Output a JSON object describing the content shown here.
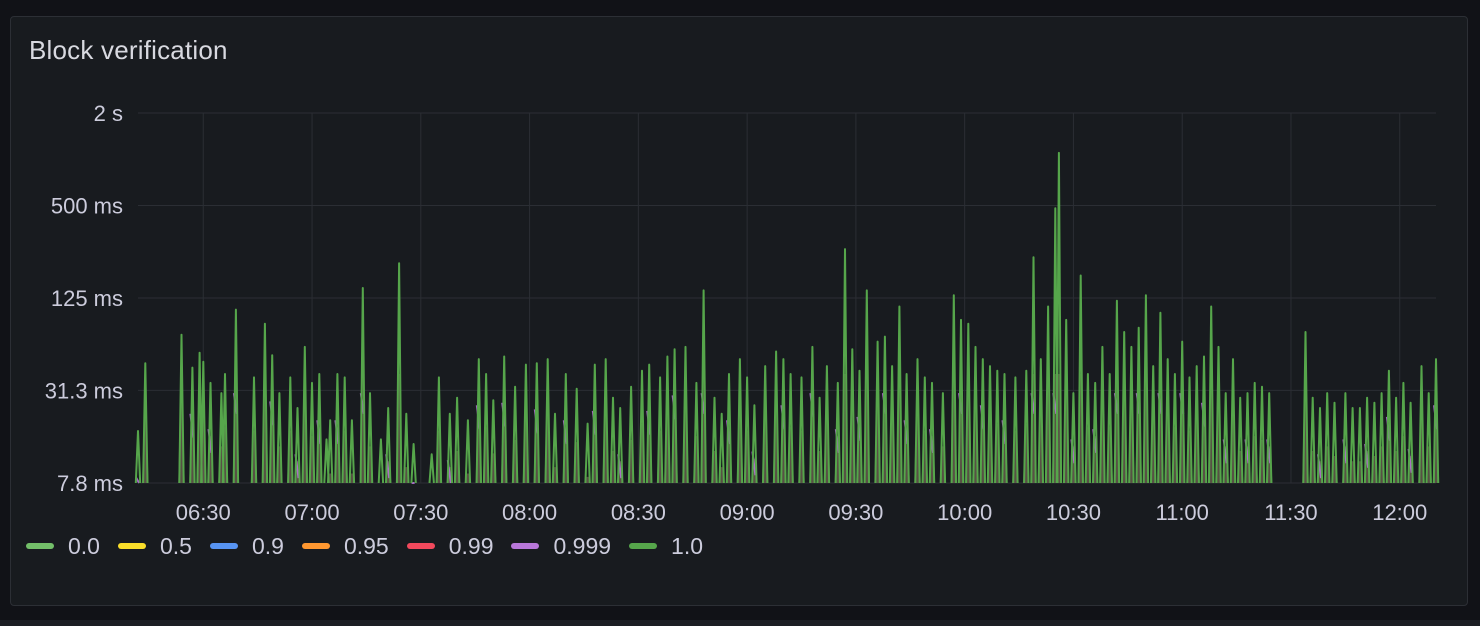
{
  "panel": {
    "title": "Block verification"
  },
  "colors": {
    "background": "#111217",
    "panel": "#181b1f",
    "grid": "#2b2e34",
    "text": "#ccccdc"
  },
  "legend": [
    {
      "label": "0.0",
      "color": "#73bf69"
    },
    {
      "label": "0.5",
      "color": "#fade2a"
    },
    {
      "label": "0.9",
      "color": "#5794f2"
    },
    {
      "label": "0.95",
      "color": "#ff9830"
    },
    {
      "label": "0.99",
      "color": "#f2495c"
    },
    {
      "label": "0.999",
      "color": "#b877d9"
    },
    {
      "label": "1.0",
      "color": "#56a64b"
    }
  ],
  "chart_data": {
    "type": "line",
    "title": "Block verification",
    "y_scale": "log2",
    "ylim_ms": [
      7.8,
      2000
    ],
    "y_ticks": [
      {
        "value": 2000,
        "label": "2 s"
      },
      {
        "value": 500,
        "label": "500 ms"
      },
      {
        "value": 125,
        "label": "125 ms"
      },
      {
        "value": 31.3,
        "label": "31.3 ms"
      },
      {
        "value": 7.8,
        "label": "7.8 ms"
      }
    ],
    "x_range": [
      "06:12",
      "12:10"
    ],
    "x_ticks": [
      "06:30",
      "07:00",
      "07:30",
      "08:00",
      "08:30",
      "09:00",
      "09:30",
      "10:00",
      "10:30",
      "11:00",
      "11:30",
      "12:00"
    ],
    "grid": true,
    "legend_position": "bottom-left",
    "series_1_0_spikes": [
      [
        "06:12",
        17
      ],
      [
        "06:14",
        47
      ],
      [
        "06:24",
        72
      ],
      [
        "06:27",
        44
      ],
      [
        "06:29",
        55
      ],
      [
        "06:30",
        48
      ],
      [
        "06:32",
        35
      ],
      [
        "06:35",
        30
      ],
      [
        "06:36",
        40
      ],
      [
        "06:39",
        105
      ],
      [
        "06:44",
        38
      ],
      [
        "06:47",
        85
      ],
      [
        "06:49",
        53
      ],
      [
        "06:51",
        30
      ],
      [
        "06:54",
        38
      ],
      [
        "06:56",
        24
      ],
      [
        "06:58",
        60
      ],
      [
        "07:00",
        35
      ],
      [
        "07:02",
        40
      ],
      [
        "07:04",
        15
      ],
      [
        "07:05",
        20
      ],
      [
        "07:07",
        40
      ],
      [
        "07:09",
        38
      ],
      [
        "07:11",
        20
      ],
      [
        "07:14",
        145
      ],
      [
        "07:16",
        30
      ],
      [
        "07:19",
        15
      ],
      [
        "07:21",
        24
      ],
      [
        "07:24",
        210
      ],
      [
        "07:26",
        22
      ],
      [
        "07:28",
        14
      ],
      [
        "07:33",
        12
      ],
      [
        "07:35",
        38
      ],
      [
        "07:38",
        22
      ],
      [
        "07:40",
        28
      ],
      [
        "07:43",
        20
      ],
      [
        "07:46",
        50
      ],
      [
        "07:48",
        40
      ],
      [
        "07:50",
        27
      ],
      [
        "07:53",
        52
      ],
      [
        "07:56",
        33
      ],
      [
        "07:59",
        46
      ],
      [
        "08:02",
        47
      ],
      [
        "08:05",
        50
      ],
      [
        "08:07",
        22
      ],
      [
        "08:10",
        40
      ],
      [
        "08:13",
        32
      ],
      [
        "08:16",
        19
      ],
      [
        "08:18",
        46
      ],
      [
        "08:21",
        50
      ],
      [
        "08:23",
        28
      ],
      [
        "08:25",
        24
      ],
      [
        "08:28",
        33
      ],
      [
        "08:31",
        42
      ],
      [
        "08:33",
        46
      ],
      [
        "08:36",
        38
      ],
      [
        "08:38",
        52
      ],
      [
        "08:40",
        58
      ],
      [
        "08:43",
        60
      ],
      [
        "08:46",
        35
      ],
      [
        "08:48",
        140
      ],
      [
        "08:51",
        28
      ],
      [
        "08:53",
        22
      ],
      [
        "08:55",
        40
      ],
      [
        "08:58",
        50
      ],
      [
        "09:00",
        38
      ],
      [
        "09:02",
        25
      ],
      [
        "09:05",
        45
      ],
      [
        "09:08",
        56
      ],
      [
        "09:10",
        50
      ],
      [
        "09:12",
        40
      ],
      [
        "09:15",
        38
      ],
      [
        "09:18",
        60
      ],
      [
        "09:20",
        28
      ],
      [
        "09:22",
        45
      ],
      [
        "09:25",
        35
      ],
      [
        "09:27",
        260
      ],
      [
        "09:29",
        58
      ],
      [
        "09:31",
        42
      ],
      [
        "09:33",
        140
      ],
      [
        "09:36",
        65
      ],
      [
        "09:38",
        70
      ],
      [
        "09:40",
        45
      ],
      [
        "09:42",
        110
      ],
      [
        "09:44",
        40
      ],
      [
        "09:47",
        50
      ],
      [
        "09:49",
        38
      ],
      [
        "09:51",
        35
      ],
      [
        "09:54",
        30
      ],
      [
        "09:57",
        130
      ],
      [
        "09:59",
        90
      ],
      [
        "10:01",
        85
      ],
      [
        "10:03",
        60
      ],
      [
        "10:05",
        50
      ],
      [
        "10:07",
        45
      ],
      [
        "10:09",
        42
      ],
      [
        "10:11",
        40
      ],
      [
        "10:14",
        38
      ],
      [
        "10:17",
        42
      ],
      [
        "10:19",
        230
      ],
      [
        "10:21",
        50
      ],
      [
        "10:23",
        110
      ],
      [
        "10:25",
        480
      ],
      [
        "10:26",
        1100
      ],
      [
        "10:28",
        90
      ],
      [
        "10:30",
        30
      ],
      [
        "10:32",
        175
      ],
      [
        "10:34",
        40
      ],
      [
        "10:36",
        35
      ],
      [
        "10:38",
        60
      ],
      [
        "10:40",
        40
      ],
      [
        "10:42",
        120
      ],
      [
        "10:44",
        75
      ],
      [
        "10:46",
        60
      ],
      [
        "10:48",
        80
      ],
      [
        "10:50",
        130
      ],
      [
        "10:52",
        45
      ],
      [
        "10:54",
        100
      ],
      [
        "10:56",
        50
      ],
      [
        "10:58",
        40
      ],
      [
        "11:00",
        65
      ],
      [
        "11:02",
        38
      ],
      [
        "11:04",
        45
      ],
      [
        "11:06",
        52
      ],
      [
        "11:08",
        110
      ],
      [
        "11:10",
        60
      ],
      [
        "11:12",
        30
      ],
      [
        "11:14",
        50
      ],
      [
        "11:16",
        28
      ],
      [
        "11:18",
        30
      ],
      [
        "11:20",
        35
      ],
      [
        "11:22",
        33
      ],
      [
        "11:24",
        30
      ],
      [
        "11:34",
        75
      ],
      [
        "11:36",
        28
      ],
      [
        "11:38",
        24
      ],
      [
        "11:40",
        30
      ],
      [
        "11:42",
        26
      ],
      [
        "11:45",
        30
      ],
      [
        "11:47",
        24
      ],
      [
        "11:49",
        24
      ],
      [
        "11:51",
        28
      ],
      [
        "11:53",
        26
      ],
      [
        "11:55",
        30
      ],
      [
        "11:57",
        42
      ],
      [
        "11:59",
        28
      ],
      [
        "12:01",
        35
      ],
      [
        "12:03",
        26
      ],
      [
        "12:06",
        45
      ],
      [
        "12:08",
        30
      ],
      [
        "12:10",
        50
      ]
    ]
  }
}
